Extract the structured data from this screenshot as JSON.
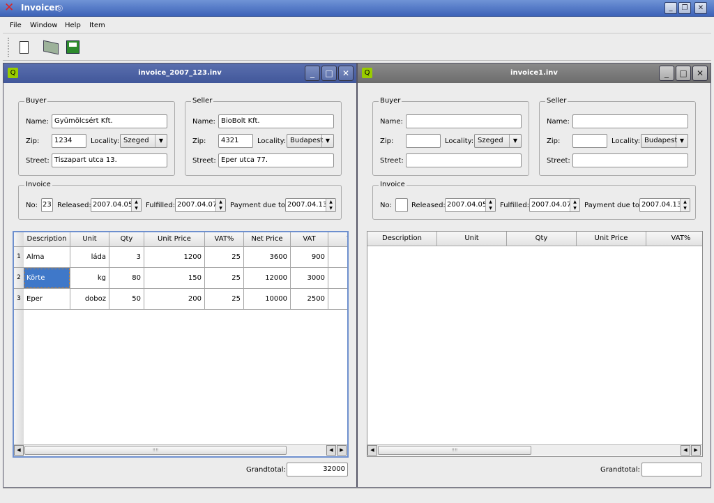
{
  "app": {
    "title": "Invoicer",
    "close_icon": "red-x-icon"
  },
  "window_buttons": {
    "minimize": "_",
    "restore": "❐",
    "close": "✕"
  },
  "menu": [
    "File",
    "Window",
    "Help",
    "Item"
  ],
  "toolbar": [
    "new-file-icon",
    "open-folder-icon",
    "save-disk-icon"
  ],
  "windows": [
    {
      "title": "invoice_2007_123.inv",
      "state": "active",
      "buyer": {
        "legend": "Buyer",
        "name_label": "Name:",
        "name": "Gyümölcsért Kft.",
        "zip_label": "Zip:",
        "zip": "1234",
        "locality_label": "Locality:",
        "locality": "Szeged",
        "street_label": "Street:",
        "street": "Tiszapart utca 13."
      },
      "seller": {
        "legend": "Seller",
        "name_label": "Name:",
        "name": "BioBolt Kft.",
        "zip_label": "Zip:",
        "zip": "4321",
        "locality_label": "Locality:",
        "locality": "Budapest",
        "street_label": "Street:",
        "street": "Eper utca 77."
      },
      "invoice": {
        "legend": "Invoice",
        "no_label": "No:",
        "no": "23",
        "released_label": "Released:",
        "released": "2007.04.05",
        "fulfilled_label": "Fulfilled:",
        "fulfilled": "2007.04.07",
        "due_label": "Payment due to:",
        "due": "2007.04.13"
      },
      "columns": [
        "Description",
        "Unit",
        "Qty",
        "Unit Price",
        "VAT%",
        "Net Price",
        "VAT",
        "T"
      ],
      "rows": [
        {
          "n": "1",
          "cells": [
            "Alma",
            "láda",
            "3",
            "1200",
            "25",
            "3600",
            "900"
          ]
        },
        {
          "n": "2",
          "cells": [
            "Körte",
            "kg",
            "80",
            "150",
            "25",
            "12000",
            "3000"
          ]
        },
        {
          "n": "3",
          "cells": [
            "Eper",
            "doboz",
            "50",
            "200",
            "25",
            "10000",
            "2500"
          ]
        }
      ],
      "selected_cell": "Körte",
      "grandtotal_label": "Grandtotal:",
      "grandtotal": "32000"
    },
    {
      "title": "invoice1.inv",
      "state": "inactive",
      "buyer": {
        "legend": "Buyer",
        "name_label": "Name:",
        "name": "",
        "zip_label": "Zip:",
        "zip": "",
        "locality_label": "Locality:",
        "locality": "Szeged",
        "street_label": "Street:",
        "street": ""
      },
      "seller": {
        "legend": "Seller",
        "name_label": "Name:",
        "name": "",
        "zip_label": "Zip:",
        "zip": "",
        "locality_label": "Locality:",
        "locality": "Budapest",
        "street_label": "Street:",
        "street": ""
      },
      "invoice": {
        "legend": "Invoice",
        "no_label": "No:",
        "no": "",
        "released_label": "Released:",
        "released": "2007.04.05",
        "fulfilled_label": "Fulfilled:",
        "fulfilled": "2007.04.07",
        "due_label": "Payment due to:",
        "due": "2007.04.13"
      },
      "columns": [
        "Description",
        "Unit",
        "Qty",
        "Unit Price",
        "VAT%"
      ],
      "rows": [],
      "grandtotal_label": "Grandtotal:",
      "grandtotal": ""
    }
  ]
}
